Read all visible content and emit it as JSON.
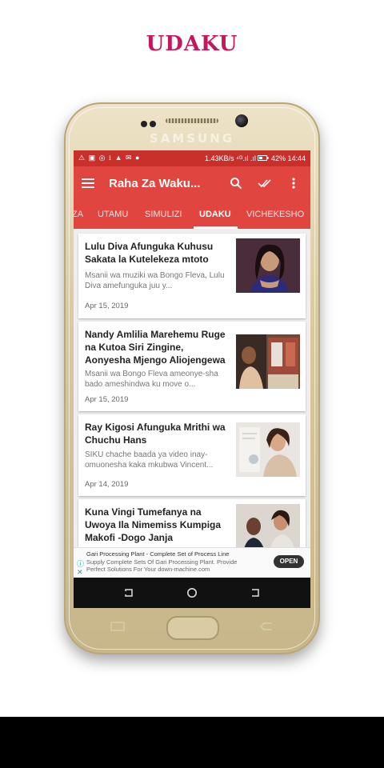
{
  "promo": {
    "title": "UDAKU",
    "title_color": "#c3185c"
  },
  "phone": {
    "brand": "SAMSUNG"
  },
  "status_bar": {
    "left_icons": "⚠ ▣ ◎ ⭳ ▲ ✉ ●",
    "network_speed": "1.43KB/s",
    "signal": "⁴ᴳ.ıl .ıl",
    "battery": "42%",
    "time": "14:44"
  },
  "app_bar": {
    "title": "Raha Za Waku...",
    "bg_color": "#e0463f",
    "icons": [
      "menu-icon",
      "search-icon",
      "done-all-icon",
      "more-vert-icon"
    ]
  },
  "tabs": {
    "items": [
      "ZA",
      "UTAMU",
      "SIMULIZI",
      "UDAKU",
      "VICHEKESHO"
    ],
    "active": "UDAKU"
  },
  "articles": [
    {
      "title": "Lulu Diva Afunguka Kuhusu Sakata la Kutelekeza mtoto",
      "excerpt": "Msanii wa muziki wa Bongo Fleva, Lulu Diva amefunguka juu y...",
      "date": "Apr 15, 2019"
    },
    {
      "title": "Nandy Amlilia Marehemu Ruge na Kutoa Siri Zingine, Aonyesha Mjengo Aliojengewa",
      "excerpt": "Msanii wa Bongo Fleva ameonye-sha bado ameshindwa ku move o...",
      "date": "Apr 15, 2019"
    },
    {
      "title": "Ray Kigosi Afunguka Mrithi wa Chuchu Hans",
      "excerpt": "SIKU chache baada ya video inay-omuonesha kaka mkubwa Vincent...",
      "date": "Apr 14, 2019"
    },
    {
      "title": "Kuna Vingi Tumefanya na Uwoya Ila Nimemiss Kumpiga Makofi -Dogo Janja",
      "excerpt": "",
      "date": ""
    }
  ],
  "ad": {
    "title": "Gari Processing Plant - Complete Set of Process Line",
    "description": "Supply Complete Sets Of Gari Processing Plant. Provide Perfect Solutions For Your down-machine.com",
    "button": "OPEN"
  },
  "nav_bar": {
    "icons": [
      "recents-icon",
      "home-icon",
      "back-icon"
    ]
  }
}
